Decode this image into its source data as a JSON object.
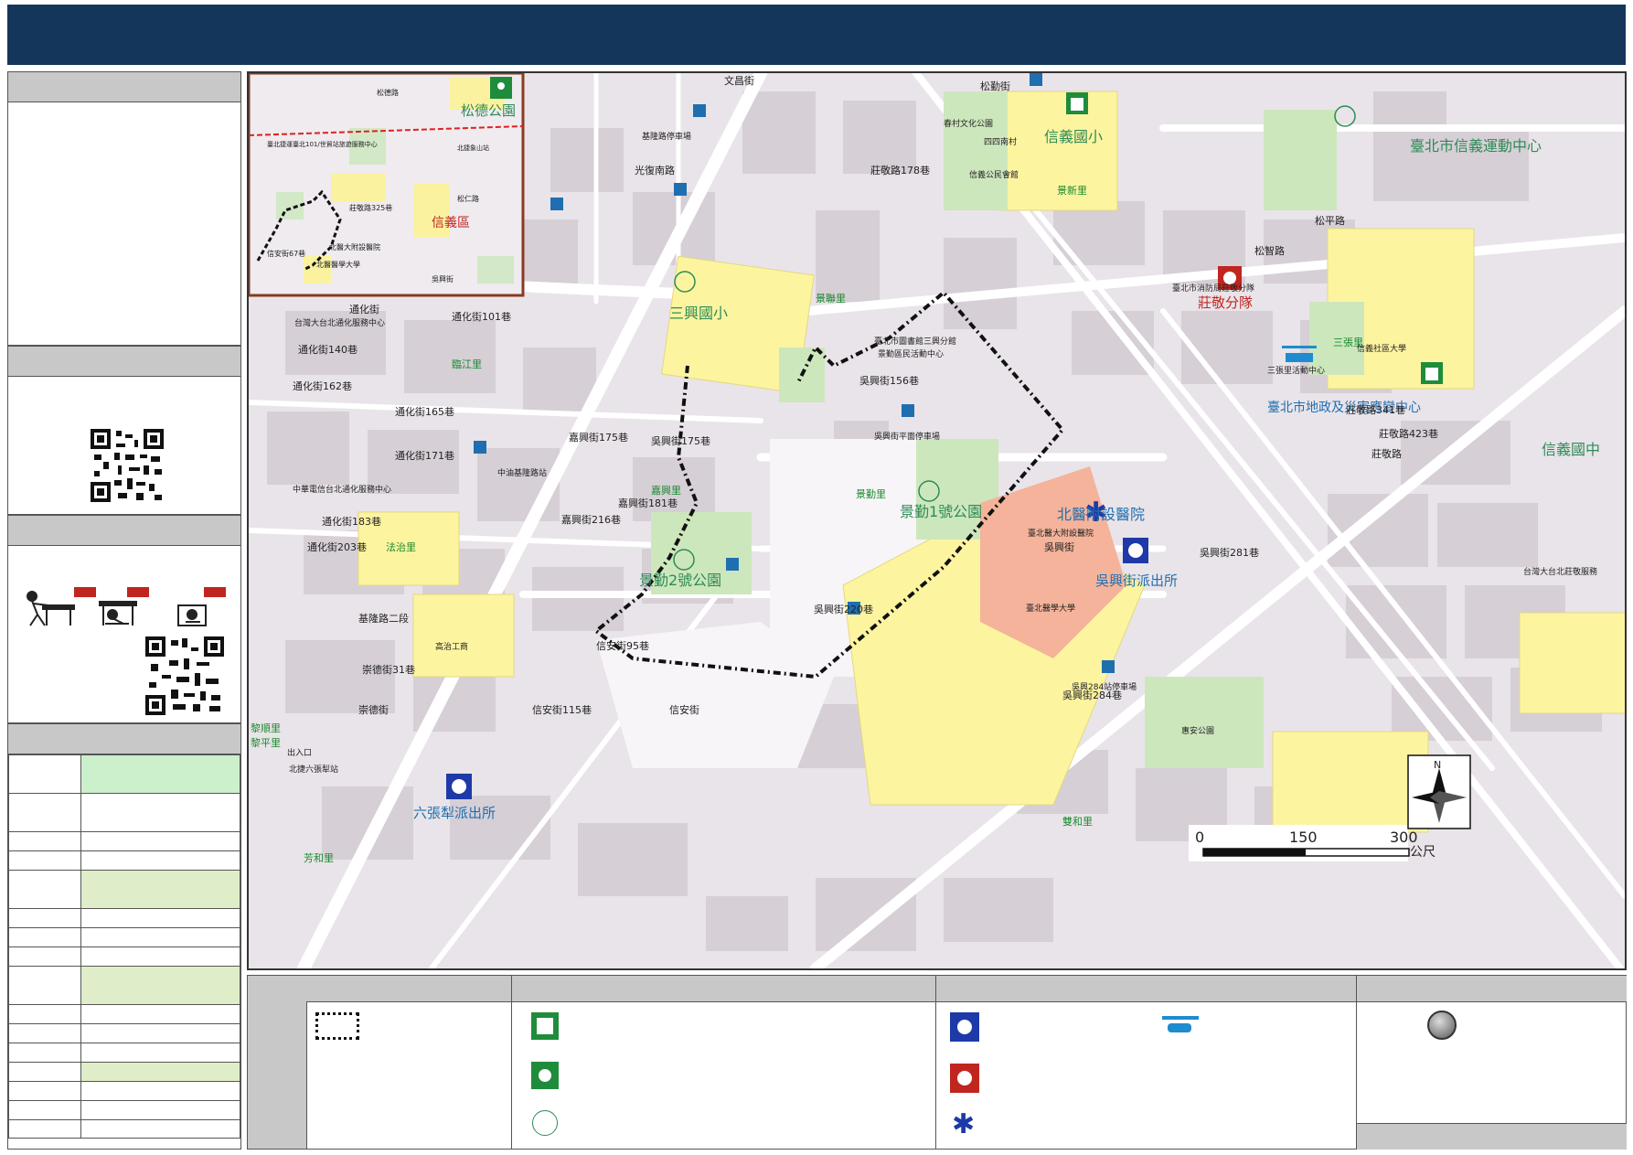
{
  "map": {
    "schools": [
      "松德公園",
      "信義國小",
      "三興國小",
      "信義國中"
    ],
    "parks": [
      "景勤1號公園",
      "景勤2號公園",
      "臺北市信義運動中心"
    ],
    "district": "信義區",
    "hospital": "北醫附設醫院",
    "police": [
      "吳興街派出所",
      "六張犁派出所"
    ],
    "fire": "莊敬分隊",
    "disaster_center": "臺北市地政及災害應變中心",
    "villages": [
      "臨江里",
      "景聯里",
      "嘉興里",
      "景勤里",
      "法治里",
      "黎順里",
      "黎平里",
      "三張里",
      "景新里",
      "雙和里",
      "芳和里"
    ],
    "streets": [
      "文昌街",
      "松勤街",
      "松平路",
      "通化街",
      "光復南路",
      "莊敬路",
      "吳興街",
      "基隆路二段",
      "信安街",
      "崇德街",
      "松智路",
      "莊敬路341巷",
      "莊敬路423巷",
      "吳興街284巷",
      "吳興街281巷",
      "吳興街220巷",
      "吳興街156巷",
      "吳興街175巷",
      "莊敬路178巷",
      "通化街101巷",
      "通化街140巷",
      "通化街162巷",
      "通化街165巷",
      "通化街171巷",
      "通化街183巷",
      "通化街203巷",
      "嘉興街175巷",
      "嘉興街181巷",
      "嘉興街216巷",
      "崇德街31巷",
      "信安街95巷",
      "信安街115巷"
    ],
    "poi": [
      "臺北醫學大學",
      "臺北醫大附設醫院",
      "中油基隆路站",
      "台灣大台北通化服務中心",
      "中華電信台北通化服務中心",
      "信義公民會館",
      "春村文化公園",
      "四四南村",
      "信義社區大學",
      "三張里活動中心",
      "臺北市消防局莊敬分隊",
      "惠安公園",
      "北捷六張犁站",
      "出入口",
      "吳興284站停車場",
      "吳興街平面停車場",
      "基隆路停車場",
      "景勤區民活動中心",
      "臺北市圖書館三興分館",
      "高治工商",
      "台灣大台北莊敬服務"
    ],
    "scale": {
      "ticks": [
        "0",
        "150",
        "300"
      ],
      "unit": "公尺"
    },
    "north": "N",
    "inset": {
      "labels": [
        "松德公園",
        "信義區",
        "北醫大附設醫院",
        "北醫醫學大學",
        "臺北捷運臺北101/世貿站旅遊服務中心",
        "北捷象山站",
        "信安街67巷",
        "吳興街",
        "松仁路",
        "莊敬路325巷",
        "松德路"
      ]
    }
  },
  "colors": {
    "title_bar": "#14365a",
    "school": "#fff7a3",
    "park": "#c8e6b8",
    "hospital": "#f4a58c",
    "block": "#dcd6dc",
    "road": "#ffffff"
  }
}
